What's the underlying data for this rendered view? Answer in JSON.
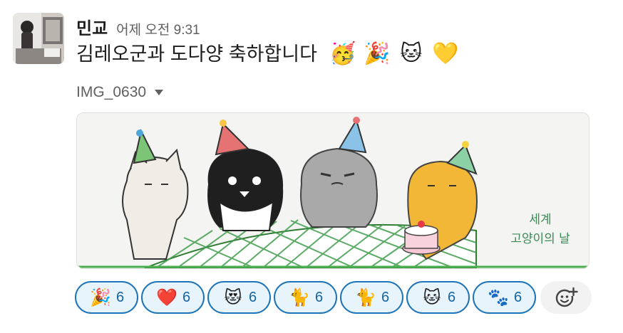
{
  "message": {
    "author": "민교",
    "timestamp": "어제 오전 9:31",
    "text": "김레오군과 도다양 축하합니다",
    "emojis": [
      {
        "name": "partying-face-emoji",
        "glyph": "🥳"
      },
      {
        "name": "party-popper-emoji",
        "glyph": "🎉"
      },
      {
        "name": "cat-face-emoji",
        "glyph": "🐱"
      },
      {
        "name": "yellow-heart-emoji",
        "glyph": "💛"
      }
    ]
  },
  "attachment": {
    "file_name": "IMG_0630",
    "image_text_line1": "세계",
    "image_text_line2": "고양이의 날"
  },
  "reactions": [
    {
      "name": "party-popper",
      "glyph": "🎉",
      "count": "6"
    },
    {
      "name": "red-heart",
      "glyph": "❤️",
      "count": "6"
    },
    {
      "name": "heart-eyes-cat",
      "glyph": "😻",
      "count": "6"
    },
    {
      "name": "black-cat",
      "glyph": "🐈",
      "count": "6"
    },
    {
      "name": "cat",
      "glyph": "🐈",
      "count": "6"
    },
    {
      "name": "cat-face",
      "glyph": "🐱",
      "count": "6"
    },
    {
      "name": "paw-prints",
      "glyph": "🐾",
      "count": "6"
    }
  ],
  "colors": {
    "reaction_border": "#1d74b8",
    "reaction_bg": "#e8f4fb",
    "reaction_count": "#1264a3",
    "timestamp": "#616061",
    "image_text": "#3c8a55"
  }
}
